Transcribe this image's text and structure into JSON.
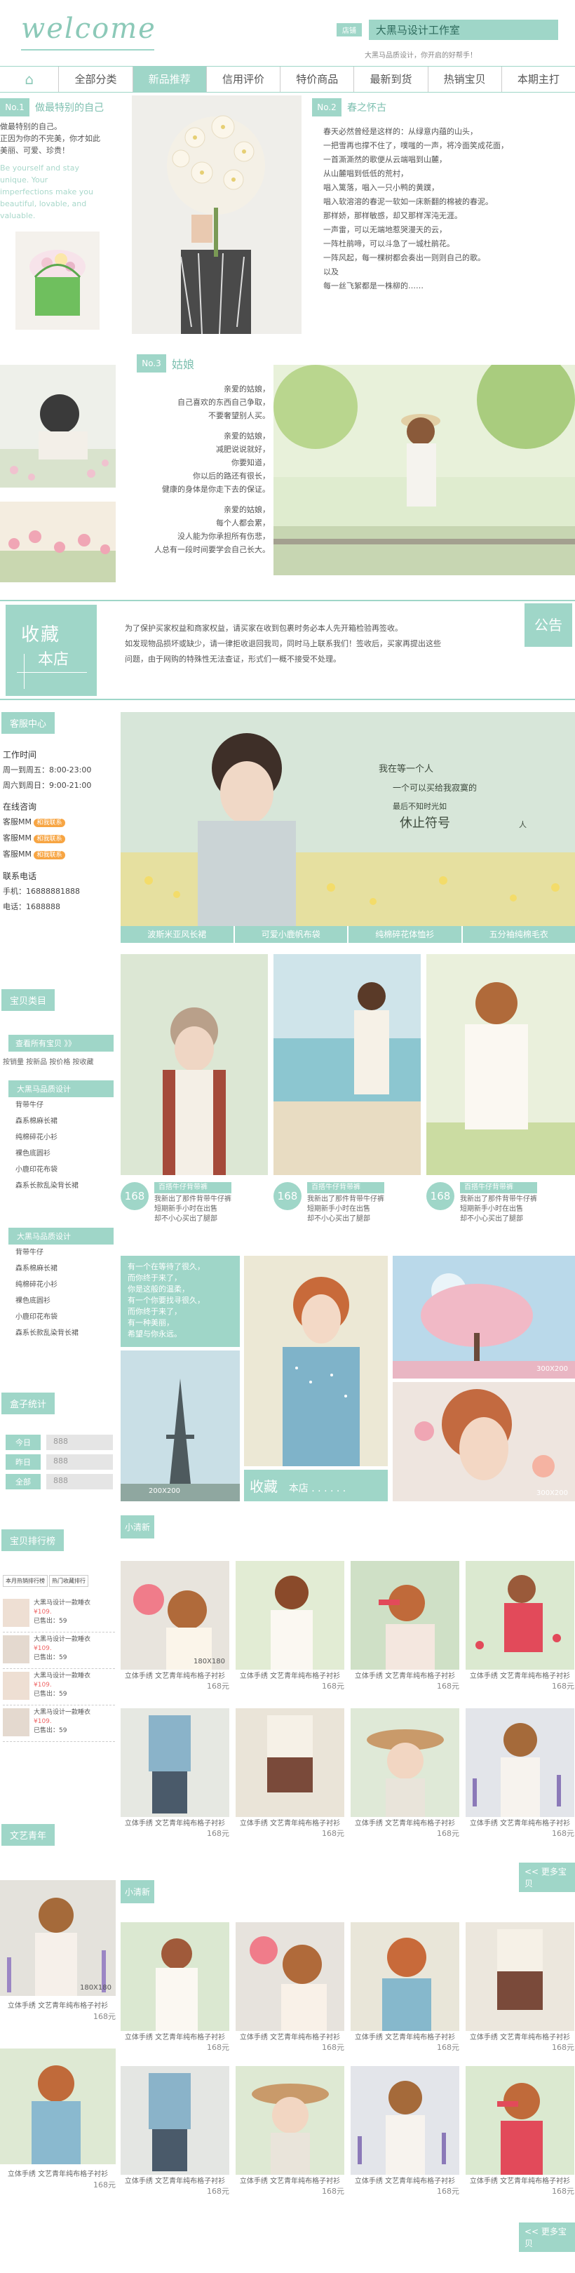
{
  "header": {
    "logo": "welcome",
    "store_tag": "店铺",
    "store_name": "大黑马设计工作室",
    "slogan": "大黑马品质设计，你开启的好帮手！"
  },
  "nav": [
    "⌂",
    "全部分类",
    "新品推荐",
    "信用评价",
    "特价商品",
    "最新到货",
    "热销宝贝",
    "本期主打"
  ],
  "feature1": {
    "num": "No.1",
    "title": "做最特别的自己",
    "lines": [
      "做最特别的自己。",
      "正因为你的不完美，你才如此",
      "美丽、可爱、珍贵！"
    ],
    "en": [
      "Be yourself and stay",
      "unique. Your",
      "imperfections make you",
      "beautiful, lovable, and",
      "valuable."
    ]
  },
  "feature2": {
    "num": "No.2",
    "title": "春之怀古",
    "lines": [
      "春天必然曾经是这样的：从绿意内蕴的山头，",
      "一把雪再也撑不住了，噗嗤的一声，将冷面笑成花面，",
      "一首澌澌然的歌便从云端唱到山麓，",
      "从山麓唱到低低的荒村，",
      "唱入篱落，唱入一只小鸭的黄蹼，",
      "唱入软溶溶的春泥一软如一床新翻的棉被的春泥。",
      "那样娇，那样敏感，却又那样浑沌无涯。",
      "一声雷，可以无端地惹哭漫天的云，",
      "一阵杜鹃啼，可以斗急了一城杜鹃花。",
      "一阵风起，每一棵树都会奏出一则则自己的歌。",
      "以及",
      "每一丝飞絮都是一株柳的……"
    ]
  },
  "feature3": {
    "num": "No.3",
    "title": "姑娘",
    "lines": [
      "亲爱的姑娘，",
      "自己喜欢的东西自己争取，",
      "不要奢望别人买。",
      "亲爱的姑娘，",
      "减肥说说就好，",
      "你要知道，",
      "你以后的路还有很长，",
      "健康的身体是你走下去的保证。",
      "亲爱的姑娘，",
      "每个人都会累，",
      "没人能为你承担所有伤悲，",
      "人总有一段时间要学会自己长大。"
    ]
  },
  "collect": {
    "title": "收藏",
    "sub": "本店"
  },
  "notice": {
    "label": "公告",
    "text": [
      "为了保护买家权益和商家权益，请买家在收到包裹时务必本人先开箱检验再签收。",
      "如发现物品损坏或缺少，请一律拒收退回我司，同时马上联系我们！签收后，买家再提出这些",
      "问题，由于网购的特殊性无法查证，形式们一概不接受不处理。"
    ]
  },
  "service": {
    "title": "客服中心",
    "work_time_title": "工作时间",
    "work_times": [
      "周一到周五：8:00-23:00",
      "周六到周日：9:00-21:00"
    ],
    "online_title": "在线咨询",
    "agents": [
      {
        "name": "客服MM",
        "badge": "和我联系"
      },
      {
        "name": "客服MM",
        "badge": "和我联系"
      },
      {
        "name": "客服MM",
        "badge": "和我联系"
      }
    ],
    "phone_title": "联系电话",
    "phones": [
      "手机：16888881888",
      "电话：1688888"
    ]
  },
  "categories": {
    "title": "宝贝类目",
    "view_all": "查看所有宝贝 》》",
    "sort_links": "按销量 按新品 按价格 按收藏",
    "groups": [
      {
        "name": "大黑马品质设计",
        "items": [
          "背带牛仔",
          "森系棉麻长裙",
          "纯棉碎花小衫",
          "裸色底圆衫",
          "小鹿印花布袋",
          "森系长款乱染背长裙"
        ]
      },
      {
        "name": "大黑马品质设计",
        "items": [
          "背带牛仔",
          "森系棉麻长裙",
          "纯棉碎花小衫",
          "裸色底圆衫",
          "小鹿印花布袋",
          "森系长款乱染背长裙"
        ]
      }
    ]
  },
  "stats": {
    "title": "盒子统计",
    "rows": [
      {
        "label": "今日",
        "value": "888"
      },
      {
        "label": "昨日",
        "value": "888"
      },
      {
        "label": "全部",
        "value": "888"
      }
    ]
  },
  "ranking": {
    "title": "宝贝排行榜",
    "tabs": [
      "本月热销排行榜",
      "热门收藏排行"
    ],
    "items": [
      {
        "name": "大黑马设计一款睡衣",
        "price": "¥109.",
        "sold": "已售出：59"
      },
      {
        "name": "大黑马设计一款睡衣",
        "price": "¥109.",
        "sold": "已售出：59"
      },
      {
        "name": "大黑马设计一款睡衣",
        "price": "¥109.",
        "sold": "已售出：59"
      },
      {
        "name": "大黑马设计一款睡衣",
        "price": "¥109.",
        "sold": "已售出：59"
      }
    ]
  },
  "literary": {
    "title": "文艺青年"
  },
  "banner": {
    "calligraphy": [
      "我在等一个人",
      "一个可以买给我寂寞的",
      "最后不知时光如",
      "休止符号",
      "人"
    ],
    "tabs": [
      "波斯米亚风长裙",
      "可爱小鹿帆布袋",
      "纯棉碎花体恤衫",
      "五分袖纯棉毛衣"
    ]
  },
  "products3": [
    {
      "price": "168",
      "name": "百搭牛仔背带裤",
      "desc": [
        "我新出了那件背带牛仔裤",
        "短期新手小时在出售",
        "却不小心买出了腿部"
      ]
    },
    {
      "price": "168",
      "name": "百搭牛仔背带裤",
      "desc": [
        "我新出了那件背带牛仔裤",
        "短期新手小时在出售",
        "却不小心买出了腿部"
      ]
    },
    {
      "price": "168",
      "name": "百搭牛仔背带裤",
      "desc": [
        "我新出了那件背带牛仔裤",
        "短期新手小时在出售",
        "却不小心买出了腿部"
      ]
    }
  ],
  "collage": {
    "quote": [
      "有一个在等待了很久，",
      "而你终于来了，",
      "你是这般的温柔，",
      "有一个你要找寻很久，",
      "而你终于来了，",
      "有一种美丽，",
      "希望与你永远。"
    ],
    "collect_title": "收藏",
    "collect_sub": "本店 . . . . . .",
    "size1": "200X200",
    "size2": "300X200",
    "size3": "300X200"
  },
  "section_fresh1": {
    "title": "小清新",
    "size": "180X180"
  },
  "section_fresh2": {
    "title": "小清新",
    "size": "180X180"
  },
  "product_caption": "立体手绣 文艺青年纯布格子衬衫",
  "product_price": "168元",
  "more": "<< 更多宝贝"
}
